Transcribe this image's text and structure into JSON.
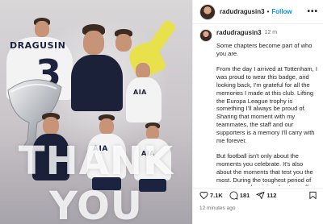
{
  "post_image": {
    "back_name": "DRAGUSIN",
    "back_number": "3",
    "sponsor": "AIA",
    "overlay_text": "THANK YOU"
  },
  "header": {
    "username": "radudragusin3",
    "follow_label": "Follow",
    "more_label": "•••"
  },
  "caption": {
    "username": "radudragusin3",
    "time": "12 m",
    "paragraphs": [
      "Some chapters become part of who you are.",
      "From the day I arrived at Tottenham, I was proud to wear this badge, and looking back, I'm grateful for all the memories I made at this club. Lifting the Europa League trophy is something I'll always be proud of. Sharing that moment with my teammates, the staff and our supporters is a memory I'll carry with me forever.",
      "But football isn't only about the moments you celebrate. It's also about the moments that test you the most. During the toughest period of my career, when injury kept me off the pitch, I never felt alone. The support I received from this club, my teammates and the incredible Spurs fans gave me"
    ]
  },
  "actions": {
    "likes": "7.1K",
    "comments": "181",
    "shares": "112"
  },
  "footer": {
    "posted": "12 minutes ago"
  },
  "colors": {
    "accent": "#0095f6",
    "text": "#262626",
    "muted": "#737373"
  },
  "icons": [
    "heart-icon",
    "comment-icon",
    "share-icon",
    "bookmark-icon"
  ]
}
